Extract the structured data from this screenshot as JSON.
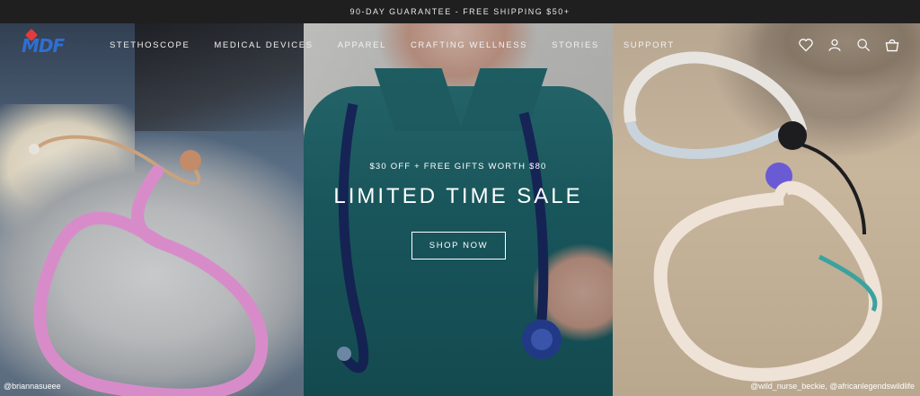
{
  "announcement": {
    "text": "90-DAY GUARANTEE - FREE SHIPPING $50+"
  },
  "header": {
    "logo_text": "MDF",
    "nav": [
      {
        "label": "STETHOSCOPE"
      },
      {
        "label": "MEDICAL DEVICES"
      },
      {
        "label": "APPAREL"
      },
      {
        "label": "CRAFTING WELLNESS"
      },
      {
        "label": "STORIES"
      },
      {
        "label": "SUPPORT"
      }
    ],
    "icons": [
      "heart-icon",
      "account-icon",
      "search-icon",
      "cart-icon"
    ]
  },
  "hero": {
    "promo_line": "$30 OFF + FREE GIFTS WORTH $80",
    "title": "LIMITED TIME SALE",
    "cta_label": "SHOP NOW",
    "credit_left": "@briannasueee",
    "credit_right": "@wild_nurse_beckie, @africanlegendswildlife"
  },
  "colors": {
    "announcement_bg": "#1f1f1f",
    "logo_blue": "#2f6fd1",
    "scrub_teal": "#1f6d74",
    "tubing_pink": "#d78cc9",
    "tubing_navy": "#1b2d6b"
  }
}
